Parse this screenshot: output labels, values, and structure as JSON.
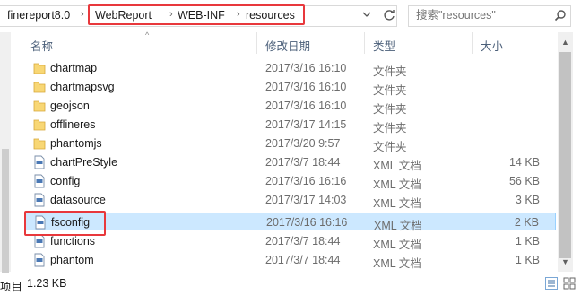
{
  "address": {
    "crumbs": [
      "finereport8.0",
      "WebReport",
      "WEB-INF",
      "resources"
    ],
    "separator": "›"
  },
  "search": {
    "placeholder": "搜索\"resources\""
  },
  "columns": {
    "name": "名称",
    "date": "修改日期",
    "type": "类型",
    "size": "大小"
  },
  "files": [
    {
      "name": "chartmap",
      "date": "2017/3/16 16:10",
      "type": "文件夹",
      "size": "",
      "kind": "folder"
    },
    {
      "name": "chartmapsvg",
      "date": "2017/3/16 16:10",
      "type": "文件夹",
      "size": "",
      "kind": "folder"
    },
    {
      "name": "geojson",
      "date": "2017/3/16 16:10",
      "type": "文件夹",
      "size": "",
      "kind": "folder"
    },
    {
      "name": "offlineres",
      "date": "2017/3/17 14:15",
      "type": "文件夹",
      "size": "",
      "kind": "folder"
    },
    {
      "name": "phantomjs",
      "date": "2017/3/20 9:57",
      "type": "文件夹",
      "size": "",
      "kind": "folder"
    },
    {
      "name": "chartPreStyle",
      "date": "2017/3/7 18:44",
      "type": "XML 文档",
      "size": "14 KB",
      "kind": "xml"
    },
    {
      "name": "config",
      "date": "2017/3/16 16:16",
      "type": "XML 文档",
      "size": "56 KB",
      "kind": "xml"
    },
    {
      "name": "datasource",
      "date": "2017/3/17 14:03",
      "type": "XML 文档",
      "size": "3 KB",
      "kind": "xml"
    },
    {
      "name": "fsconfig",
      "date": "2017/3/16 16:16",
      "type": "XML 文档",
      "size": "2 KB",
      "kind": "xml",
      "selected": true
    },
    {
      "name": "functions",
      "date": "2017/3/7 18:44",
      "type": "XML 文档",
      "size": "1 KB",
      "kind": "xml"
    },
    {
      "name": "phantom",
      "date": "2017/3/7 18:44",
      "type": "XML 文档",
      "size": "1 KB",
      "kind": "xml"
    }
  ],
  "status": {
    "count": "项目",
    "size": "1.23 KB"
  },
  "colors": {
    "selection": "#cce8ff",
    "highlight": "#e8383c",
    "folder": "#f8d775"
  }
}
